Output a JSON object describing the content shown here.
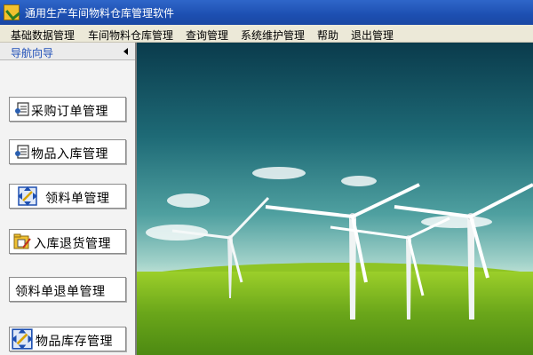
{
  "window": {
    "title": "通用生产车间物料仓库管理软件"
  },
  "menu": [
    {
      "label": "基础数据管理"
    },
    {
      "label": "车间物料仓库管理"
    },
    {
      "label": "查询管理"
    },
    {
      "label": "系统维护管理"
    },
    {
      "label": "帮助"
    },
    {
      "label": "退出管理"
    }
  ],
  "nav": {
    "title": "导航向导",
    "buttons": [
      {
        "label": "采购订单管理",
        "icon": "document-check-icon"
      },
      {
        "label": "物品入库管理",
        "icon": "document-check-icon"
      },
      {
        "label": "领料单管理",
        "icon": "move-arrows-icon"
      },
      {
        "label": "入库退货管理",
        "icon": "folder-edit-icon"
      },
      {
        "label": "领料单退单管理",
        "icon": ""
      },
      {
        "label": "物品库存管理",
        "icon": "move-arrows-icon"
      }
    ]
  },
  "main": {
    "image": "wind-turbines-landscape"
  },
  "colors": {
    "titlebar": "#1d4fb1",
    "nav_title": "#1f4fb8",
    "grass": "#8fc424",
    "sky": "#1e6a76"
  }
}
